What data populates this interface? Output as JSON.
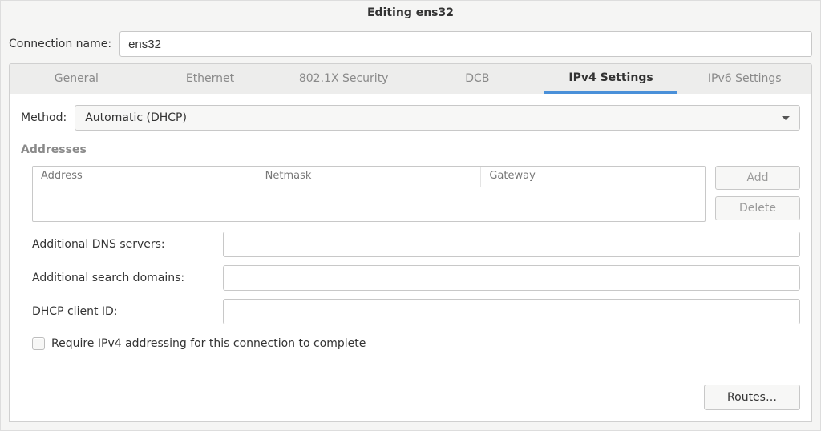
{
  "window": {
    "title": "Editing ens32"
  },
  "name_row": {
    "label": "Connection name:",
    "value": "ens32"
  },
  "tabs": {
    "items": [
      {
        "label": "General",
        "active": false
      },
      {
        "label": "Ethernet",
        "active": false
      },
      {
        "label": "802.1X Security",
        "active": false
      },
      {
        "label": "DCB",
        "active": false
      },
      {
        "label": "IPv4 Settings",
        "active": true
      },
      {
        "label": "IPv6 Settings",
        "active": false
      }
    ]
  },
  "method": {
    "label": "Method:",
    "selected": "Automatic (DHCP)"
  },
  "addresses": {
    "section_title": "Addresses",
    "columns": {
      "address": "Address",
      "netmask": "Netmask",
      "gateway": "Gateway"
    },
    "rows": []
  },
  "buttons": {
    "add": "Add",
    "delete": "Delete",
    "routes": "Routes…"
  },
  "fields": {
    "dns_label": "Additional DNS servers:",
    "dns_value": "",
    "search_label": "Additional search domains:",
    "search_value": "",
    "client_id_label": "DHCP client ID:",
    "client_id_value": ""
  },
  "checkbox": {
    "label": "Require IPv4 addressing for this connection to complete",
    "checked": false
  }
}
